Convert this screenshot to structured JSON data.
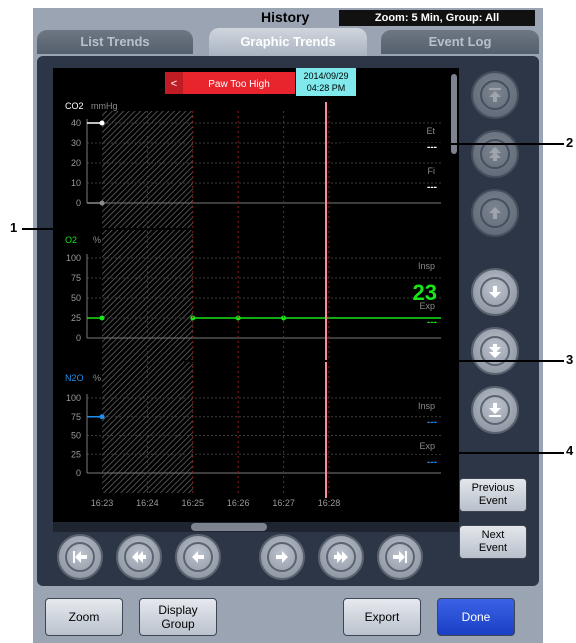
{
  "window": {
    "title": "History",
    "zoom_info": "Zoom: 5 Min, Group: All"
  },
  "tabs": [
    {
      "label": "List Trends",
      "active": false
    },
    {
      "label": "Graphic Trends",
      "active": true
    },
    {
      "label": "Event Log",
      "active": false
    }
  ],
  "event_marker": {
    "label": "Paw Too High",
    "arrow": "<"
  },
  "cursor": {
    "date": "2014/09/29",
    "time": "04:28 PM"
  },
  "time_axis": [
    "16:23",
    "16:24",
    "16:25",
    "16:26",
    "16:27",
    "16:28"
  ],
  "graphs": [
    {
      "name": "CO2",
      "unit": "mmHg",
      "ticks": [
        "40",
        "30",
        "20",
        "10",
        "0"
      ],
      "color": "#ffffff",
      "readouts": [
        {
          "label": "Et",
          "value": "---"
        },
        {
          "label": "Fi",
          "value": "---"
        }
      ]
    },
    {
      "name": "O2",
      "unit": "%",
      "ticks": [
        "100",
        "75",
        "50",
        "25",
        "0"
      ],
      "color": "#19e619",
      "readouts": [
        {
          "label": "Insp",
          "value": "23"
        },
        {
          "label": "Exp",
          "value": "---"
        }
      ]
    },
    {
      "name": "N2O",
      "unit": "%",
      "ticks": [
        "100",
        "75",
        "50",
        "25",
        "0"
      ],
      "color": "#1e8ff0",
      "readouts": [
        {
          "label": "Insp",
          "value": "---"
        },
        {
          "label": "Exp",
          "value": "---"
        }
      ]
    }
  ],
  "chart_data": [
    {
      "type": "line",
      "title": "CO2",
      "ylabel": "mmHg",
      "x": [
        "16:23"
      ],
      "ylim": [
        0,
        40
      ],
      "series": [
        {
          "values": [
            40
          ]
        },
        {
          "values": [
            0
          ]
        }
      ]
    },
    {
      "type": "line",
      "title": "O2",
      "ylabel": "%",
      "x": [
        "16:23",
        "16:25",
        "16:26",
        "16:27"
      ],
      "ylim": [
        0,
        100
      ],
      "series": [
        {
          "values": [
            25,
            25,
            25,
            25
          ]
        }
      ]
    },
    {
      "type": "line",
      "title": "N2O",
      "ylabel": "%",
      "x": [
        "16:23"
      ],
      "ylim": [
        0,
        100
      ],
      "series": [
        {
          "values": [
            75
          ]
        }
      ]
    }
  ],
  "side_buttons": {
    "scroll": [
      "page-top-icon",
      "page-up-icon",
      "up-icon",
      "down-icon",
      "page-down-icon",
      "page-bottom-icon"
    ],
    "previous_event": "Previous Event",
    "next_event": "Next Event"
  },
  "nav_buttons": [
    "first-icon",
    "fast-back-icon",
    "back-icon",
    "forward-icon",
    "fast-forward-icon",
    "last-icon"
  ],
  "bottom_buttons": {
    "zoom": "Zoom",
    "display_group": "Display Group",
    "export": "Export",
    "done": "Done"
  },
  "callouts": [
    "1",
    "2",
    "3",
    "4"
  ]
}
